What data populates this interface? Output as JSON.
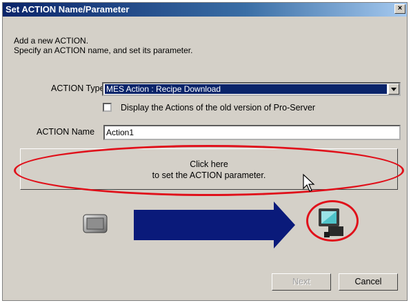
{
  "window": {
    "title": "Set ACTION Name/Parameter",
    "close_glyph": "×"
  },
  "intro": {
    "line1": "Add a new ACTION.",
    "line2": "Specify an ACTION name, and set its parameter."
  },
  "action_type": {
    "label": "ACTION Type",
    "selected": "MES Action : Recipe Download"
  },
  "old_version_checkbox": {
    "label": "Display the Actions of the old version of Pro-Server",
    "checked": false
  },
  "action_name": {
    "label": "ACTION Name",
    "value": "Action1"
  },
  "parameter_button": {
    "line1": "Click here",
    "line2": "to set the ACTION parameter."
  },
  "footer": {
    "next_label": "Next",
    "next_enabled": false,
    "cancel_label": "Cancel"
  },
  "colors": {
    "highlight_ellipse": "#e0101a",
    "arrow": "#0a1a7a",
    "selection": "#0a246a"
  },
  "icons": [
    "display-terminal-icon",
    "flow-arrow-icon",
    "server-pc-icon",
    "mouse-cursor-icon"
  ]
}
